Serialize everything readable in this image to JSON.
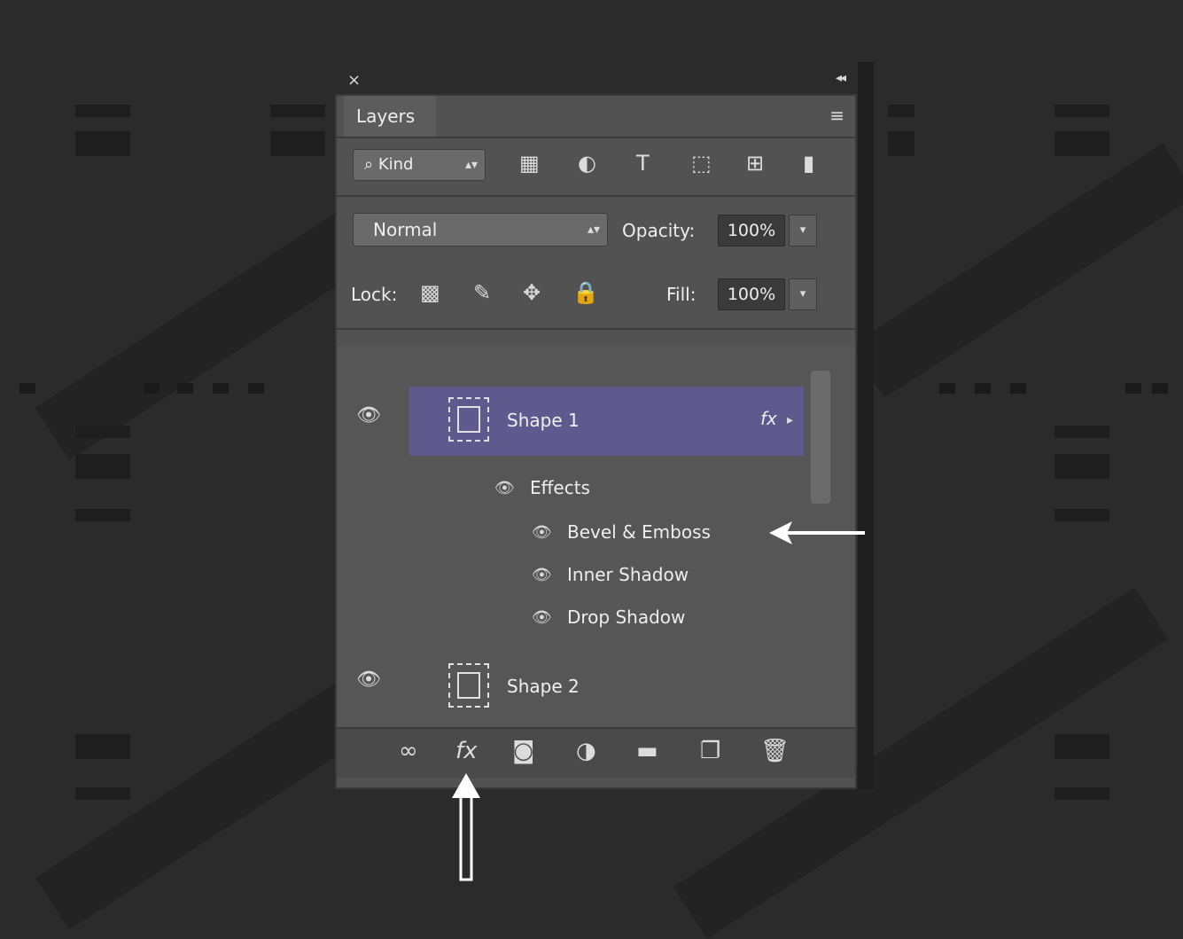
{
  "panel": {
    "close_glyph": "×",
    "collapse_glyph": "◂◂",
    "tab_label": "Layers",
    "menu_glyph": "≡"
  },
  "filter": {
    "kind_label": "Kind",
    "kind_glyph": "⌕",
    "icons": [
      {
        "name": "pixel-filter-icon",
        "glyph": "▦"
      },
      {
        "name": "adjustment-filter-icon",
        "glyph": "◐"
      },
      {
        "name": "type-filter-icon",
        "glyph": "T"
      },
      {
        "name": "shape-filter-icon",
        "glyph": "⬚"
      },
      {
        "name": "smart-object-filter-icon",
        "glyph": "⊞"
      },
      {
        "name": "filter-toggle-icon",
        "glyph": "▮"
      }
    ]
  },
  "blend": {
    "mode": "Normal",
    "opacity_label": "Opacity:",
    "opacity_value": "100%"
  },
  "lock": {
    "label": "Lock:",
    "icons": [
      {
        "name": "lock-transparent-icon",
        "glyph": "▩"
      },
      {
        "name": "lock-image-icon",
        "glyph": "✎"
      },
      {
        "name": "lock-position-icon",
        "glyph": "✥"
      },
      {
        "name": "lock-all-icon",
        "glyph": "🔒"
      }
    ],
    "fill_label": "Fill:",
    "fill_value": "100%"
  },
  "layers": [
    {
      "name": "Shape 1",
      "selected": true,
      "fx": "fx",
      "effects_label": "Effects",
      "effects": [
        "Bevel & Emboss",
        "Inner Shadow",
        "Drop Shadow"
      ]
    },
    {
      "name": "Shape 2",
      "selected": false
    }
  ],
  "bottom_bar": [
    {
      "name": "link-layers-icon",
      "glyph": "∞"
    },
    {
      "name": "add-layer-style-icon",
      "glyph": "fx"
    },
    {
      "name": "add-mask-icon",
      "glyph": "◙"
    },
    {
      "name": "new-adjustment-layer-icon",
      "glyph": "◑"
    },
    {
      "name": "new-group-icon",
      "glyph": "▬"
    },
    {
      "name": "new-layer-icon",
      "glyph": "❐"
    },
    {
      "name": "delete-layer-icon",
      "glyph": "🗑"
    }
  ],
  "colors": {
    "background": "#2b2b2b",
    "panel": "#525252",
    "selected_layer": "#5e5a8e"
  }
}
